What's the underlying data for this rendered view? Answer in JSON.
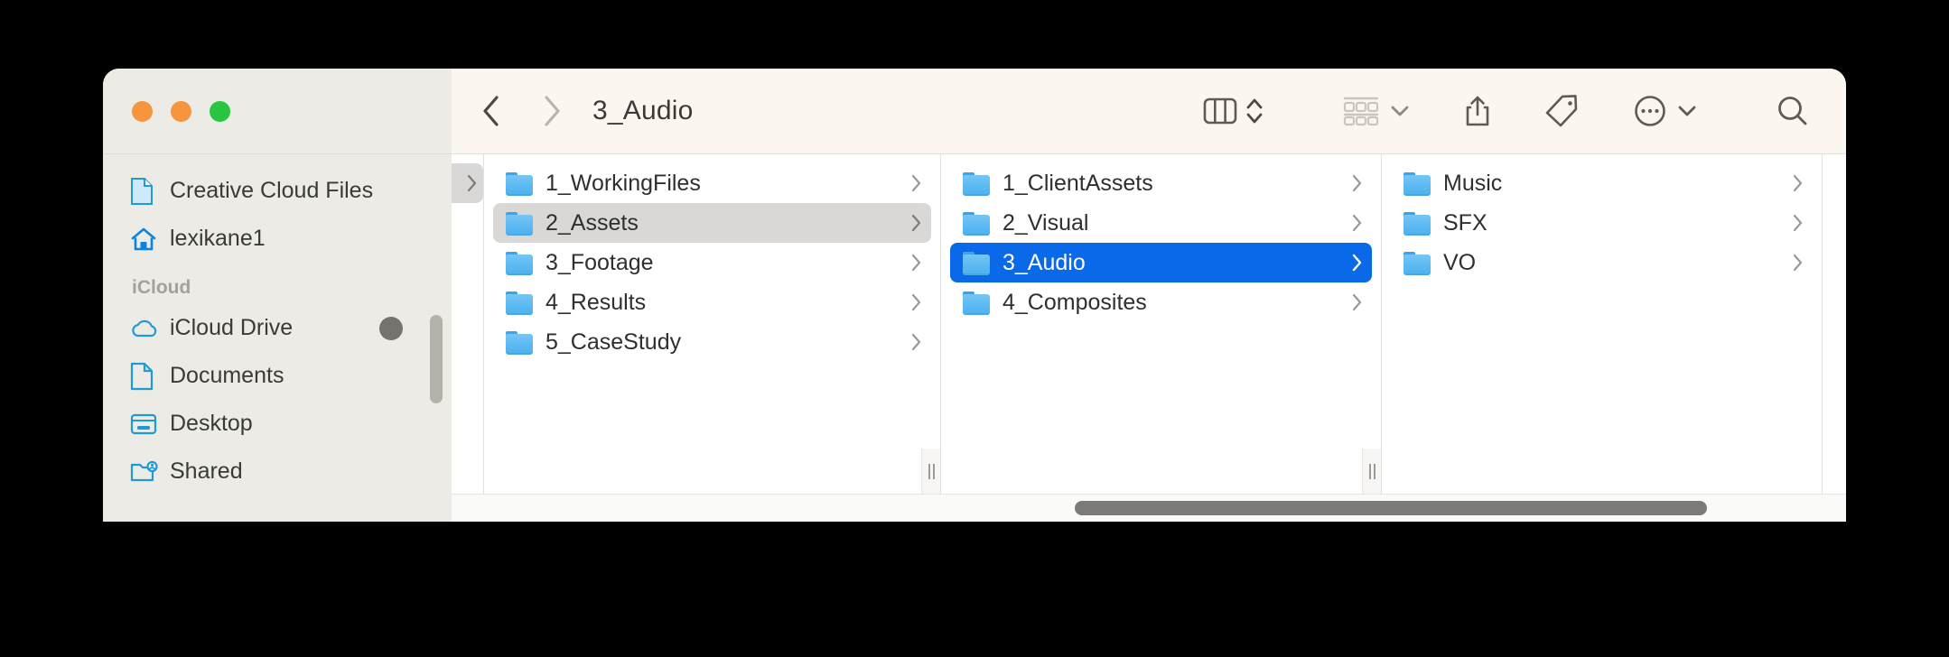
{
  "window": {
    "traffic_lights": [
      {
        "name": "close",
        "color": "#f7943e"
      },
      {
        "name": "minimize",
        "color": "#f7943e"
      },
      {
        "name": "zoom",
        "color": "#28c53f"
      }
    ]
  },
  "toolbar": {
    "back_label": "Back",
    "forward_label": "Forward",
    "title": "3_Audio",
    "view_mode_label": "Column View",
    "view_mode_stepper_label": "Change view",
    "group_by_label": "Group items",
    "group_by_chevron_label": "Group options",
    "share_label": "Share",
    "tag_label": "Tags",
    "more_label": "More",
    "more_chevron_label": "More options",
    "search_label": "Search"
  },
  "sidebar": {
    "top_items": [
      {
        "label": "Creative Cloud Files",
        "icon": "document-icon"
      },
      {
        "label": "lexikane1",
        "icon": "home-icon"
      }
    ],
    "section_header": "iCloud",
    "icloud_items": [
      {
        "label": "iCloud Drive",
        "icon": "cloud-icon",
        "badge": true
      },
      {
        "label": "Documents",
        "icon": "document-icon",
        "badge": false
      },
      {
        "label": "Desktop",
        "icon": "desktop-icon",
        "badge": false
      },
      {
        "label": "Shared",
        "icon": "shared-folder-icon",
        "badge": false
      }
    ]
  },
  "columns": [
    {
      "name": "column-1",
      "items": [
        {
          "label": "1_WorkingFiles",
          "selected": "none"
        },
        {
          "label": "2_Assets",
          "selected": "inactive"
        },
        {
          "label": "3_Footage",
          "selected": "none"
        },
        {
          "label": "4_Results",
          "selected": "none"
        },
        {
          "label": "5_CaseStudy",
          "selected": "none"
        }
      ]
    },
    {
      "name": "column-2",
      "items": [
        {
          "label": "1_ClientAssets",
          "selected": "none"
        },
        {
          "label": "2_Visual",
          "selected": "none"
        },
        {
          "label": "3_Audio",
          "selected": "active"
        },
        {
          "label": "4_Composites",
          "selected": "none"
        }
      ]
    },
    {
      "name": "column-3",
      "items": [
        {
          "label": "Music",
          "selected": "none"
        },
        {
          "label": "SFX",
          "selected": "none"
        },
        {
          "label": "VO",
          "selected": "none"
        }
      ]
    }
  ],
  "colors": {
    "selection_active": "#0a69e8",
    "selection_inactive": "#d9d8d6",
    "sidebar_bg": "#ecebe6",
    "toolbar_bg": "#fbf7f0",
    "folder_blue": "#5bb9f2",
    "icon_accent": "#1f9ad6"
  },
  "scrollbars": {
    "sidebar_vertical_label": "Sidebar scrollbar",
    "horizontal_label": "Horizontal scrollbar"
  }
}
